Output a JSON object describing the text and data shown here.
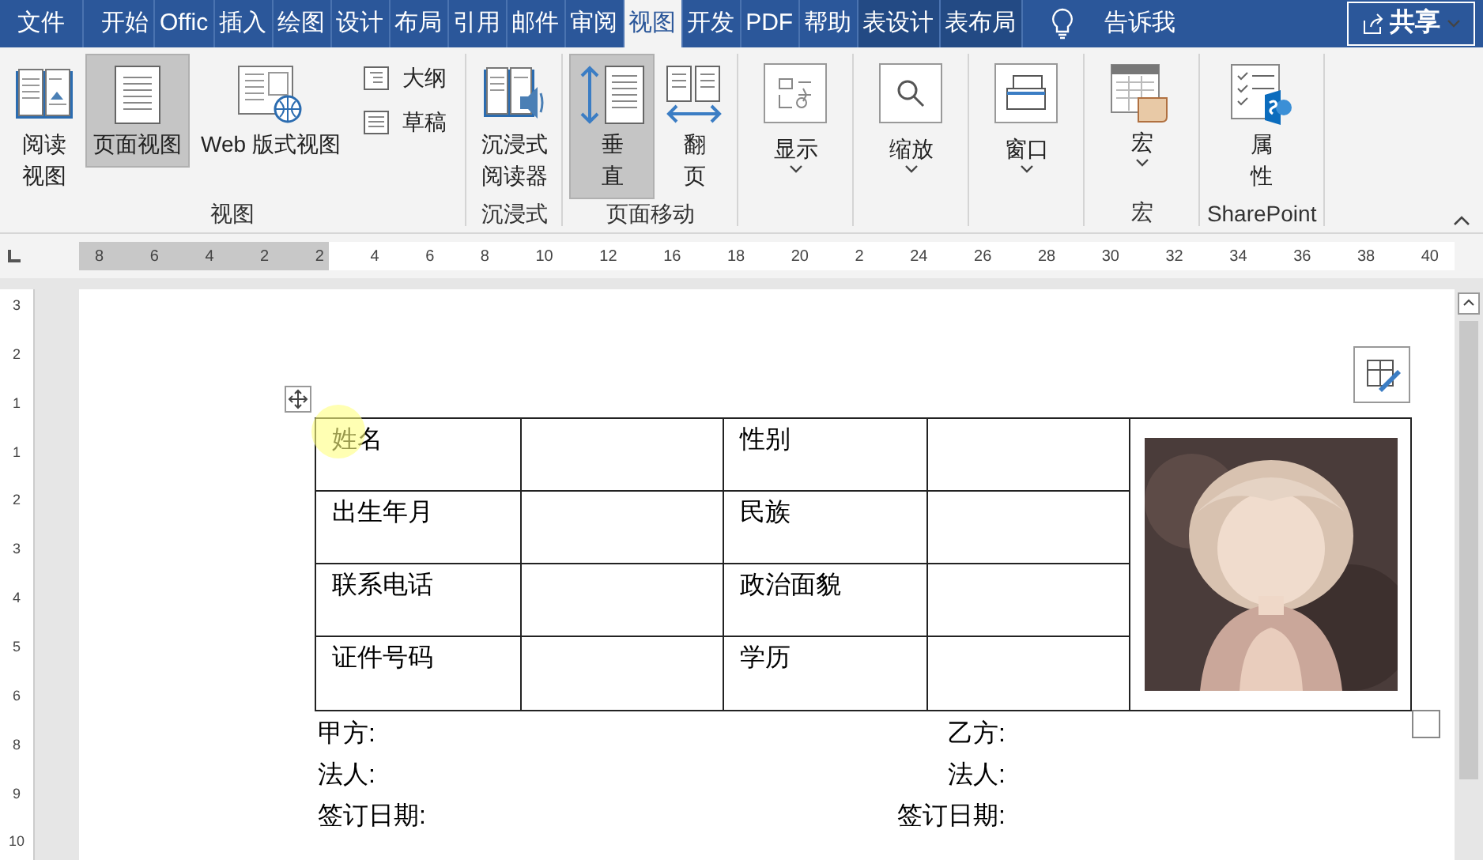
{
  "tabs": [
    {
      "label": "文件",
      "selected": false,
      "kind": "plain"
    },
    {
      "label": "开始",
      "selected": false,
      "kind": "plain"
    },
    {
      "label": "Offic",
      "selected": false,
      "kind": "plain"
    },
    {
      "label": "插入",
      "selected": false,
      "kind": "plain"
    },
    {
      "label": "绘图",
      "selected": false,
      "kind": "plain"
    },
    {
      "label": "设计",
      "selected": false,
      "kind": "plain"
    },
    {
      "label": "布局",
      "selected": false,
      "kind": "plain"
    },
    {
      "label": "引用",
      "selected": false,
      "kind": "plain"
    },
    {
      "label": "邮件",
      "selected": false,
      "kind": "plain"
    },
    {
      "label": "审阅",
      "selected": false,
      "kind": "plain"
    },
    {
      "label": "视图",
      "selected": true,
      "kind": "plain"
    },
    {
      "label": "开发",
      "selected": false,
      "kind": "plain"
    },
    {
      "label": "PDF",
      "selected": false,
      "kind": "plain"
    },
    {
      "label": "帮助",
      "selected": false,
      "kind": "plain"
    },
    {
      "label": "表设计",
      "selected": false,
      "kind": "context"
    },
    {
      "label": "表布局",
      "selected": false,
      "kind": "context"
    }
  ],
  "tell_me": "告诉我",
  "share": "共享",
  "ribbon_groups": [
    {
      "label": "视图",
      "items": [
        {
          "kind": "large",
          "lines": [
            "阅读",
            "视图"
          ],
          "selected": false
        },
        {
          "kind": "large",
          "lines": [
            "页面视图"
          ],
          "selected": true
        },
        {
          "kind": "large",
          "lines": [
            "Web 版式视图"
          ],
          "selected": false
        },
        {
          "kind": "small",
          "lines": [
            "大纲"
          ]
        },
        {
          "kind": "small",
          "lines": [
            "草稿"
          ]
        }
      ]
    },
    {
      "label": "沉浸式",
      "items": [
        {
          "kind": "large",
          "lines": [
            "沉浸式",
            "阅读器"
          ],
          "selected": false
        }
      ]
    },
    {
      "label": "页面移动",
      "items": [
        {
          "kind": "large",
          "lines": [
            "垂",
            "直"
          ],
          "selected": true
        },
        {
          "kind": "large",
          "lines": [
            "翻",
            "页"
          ],
          "selected": false
        }
      ]
    },
    {
      "items": [
        {
          "kind": "dropdown",
          "lines": [
            "显示"
          ]
        }
      ]
    },
    {
      "items": [
        {
          "kind": "dropdown",
          "lines": [
            "缩放"
          ]
        }
      ]
    },
    {
      "items": [
        {
          "kind": "dropdown",
          "lines": [
            "窗口"
          ]
        }
      ]
    },
    {
      "label": "宏",
      "items": [
        {
          "kind": "menu",
          "lines": [
            "宏"
          ]
        }
      ]
    },
    {
      "label": "SharePoint",
      "items": [
        {
          "kind": "large",
          "lines": [
            "属",
            "性"
          ],
          "selected": false
        }
      ]
    }
  ],
  "ruler_labels": [
    "8",
    "6",
    "4",
    "2",
    "2",
    "4",
    "6",
    "8",
    "10",
    "12",
    "16",
    "18",
    "20",
    "2",
    "24",
    "26",
    "28",
    "30",
    "32",
    "34",
    "36",
    "38",
    "40"
  ],
  "vertical_ruler_labels": [
    "3",
    "2",
    "1",
    "1",
    "2",
    "3",
    "4",
    "5",
    "6",
    "8",
    "9",
    "10"
  ],
  "table": {
    "rows": [
      {
        "field_1": "姓名",
        "field_2": "性别"
      },
      {
        "field_1": "出生年月",
        "field_2": "民族"
      },
      {
        "field_1": "联系电话",
        "field_2": "政治面貌"
      },
      {
        "field_1": "证件号码",
        "field_2": "学历"
      }
    ]
  },
  "signature_lines": [
    {
      "left": "甲方:",
      "right": "乙方:"
    },
    {
      "left": "法人:",
      "right": "法人:"
    },
    {
      "left": "签订日期:",
      "right": "签订日期:"
    }
  ]
}
